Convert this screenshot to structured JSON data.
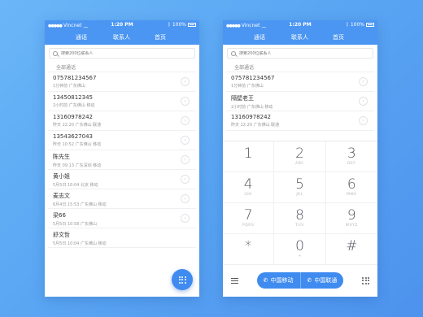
{
  "colors": {
    "accent": "#4b96f2",
    "fab": "#3f8bef",
    "background": "#5aa6f3"
  },
  "status": {
    "carrier": "Vincnet",
    "time": "1:20 PM",
    "battery": "100%"
  },
  "nav": {
    "calls": "通话",
    "contacts": "联系人",
    "home": "首页"
  },
  "search": {
    "placeholder": "搜索200位联系人"
  },
  "left": {
    "section": "全部通话",
    "rows": [
      {
        "name": "075781234567",
        "sub": "1分钟前  广东佛山"
      },
      {
        "name": "13450812345",
        "sub": "2小时前  广东佛山  移动"
      },
      {
        "name": "13160978242",
        "sub": "昨天 22:20  广东佛山  联通"
      },
      {
        "name": "13543627043",
        "sub": "昨天 10:52  广东佛山  移动"
      },
      {
        "name": "陈先生",
        "sub": "昨天 09:13  广东深圳  移动"
      },
      {
        "name": "黄小姐",
        "sub": "5月5日 10:04  北京  移动"
      },
      {
        "name": "麦志文",
        "sub": "6月4日 15:53  广东佛山  移动"
      },
      {
        "name": "梁66",
        "sub": "5月5日 10:58  广东佛山"
      },
      {
        "name": "舒文哲",
        "sub": "5月5日 10:04  广东佛山  移动"
      }
    ]
  },
  "right": {
    "section": "全部通话",
    "rows": [
      {
        "name": "075781234567",
        "sub": "1分钟前  广东佛山"
      },
      {
        "name": "隔壁老王",
        "sub": "2小时前  广东佛山  移动"
      },
      {
        "name": "13160978242",
        "sub": "昨天 22:20  广东佛山  联通"
      }
    ],
    "keys": [
      {
        "num": "1",
        "letters": ""
      },
      {
        "num": "2",
        "letters": "ABC"
      },
      {
        "num": "3",
        "letters": "DEF"
      },
      {
        "num": "4",
        "letters": "GHI"
      },
      {
        "num": "5",
        "letters": "JKL"
      },
      {
        "num": "6",
        "letters": "MNO"
      },
      {
        "num": "7",
        "letters": "PQRS"
      },
      {
        "num": "8",
        "letters": "TUV"
      },
      {
        "num": "9",
        "letters": "WXYZ"
      },
      {
        "num": "*",
        "letters": ""
      },
      {
        "num": "0",
        "letters": "+"
      },
      {
        "num": "#",
        "letters": ""
      }
    ],
    "call_mobile": "中国移动",
    "call_unicom": "中国联通"
  }
}
